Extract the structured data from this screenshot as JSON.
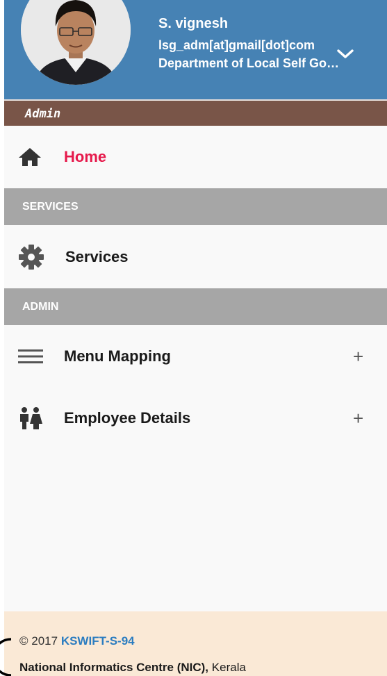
{
  "profile": {
    "name": "S. vignesh",
    "email": "lsg_adm[at]gmail[dot]com",
    "department": "Department of Local Self Government",
    "toggle_icon": "chevron-down-icon",
    "header_color": "#4682b4"
  },
  "role": {
    "label": "Admin",
    "bar_color": "#795548"
  },
  "menu": {
    "home": {
      "label": "Home",
      "icon": "home-icon",
      "color": "#e6194b"
    },
    "services_header": "SERVICES",
    "services": {
      "label": "Services",
      "icon": "gear-icon"
    },
    "admin_header": "ADMIN",
    "menu_mapping": {
      "label": "Menu Mapping",
      "icon": "menu-lines-icon",
      "expand": "+"
    },
    "employee_details": {
      "label": "Employee Details",
      "icon": "people-icon",
      "expand": "+"
    }
  },
  "footer": {
    "copyright": "© 2017",
    "version": "KSWIFT-S-94",
    "org": "National Informatics Centre (NIC),",
    "location": "Kerala",
    "background": "#fae9d6"
  }
}
